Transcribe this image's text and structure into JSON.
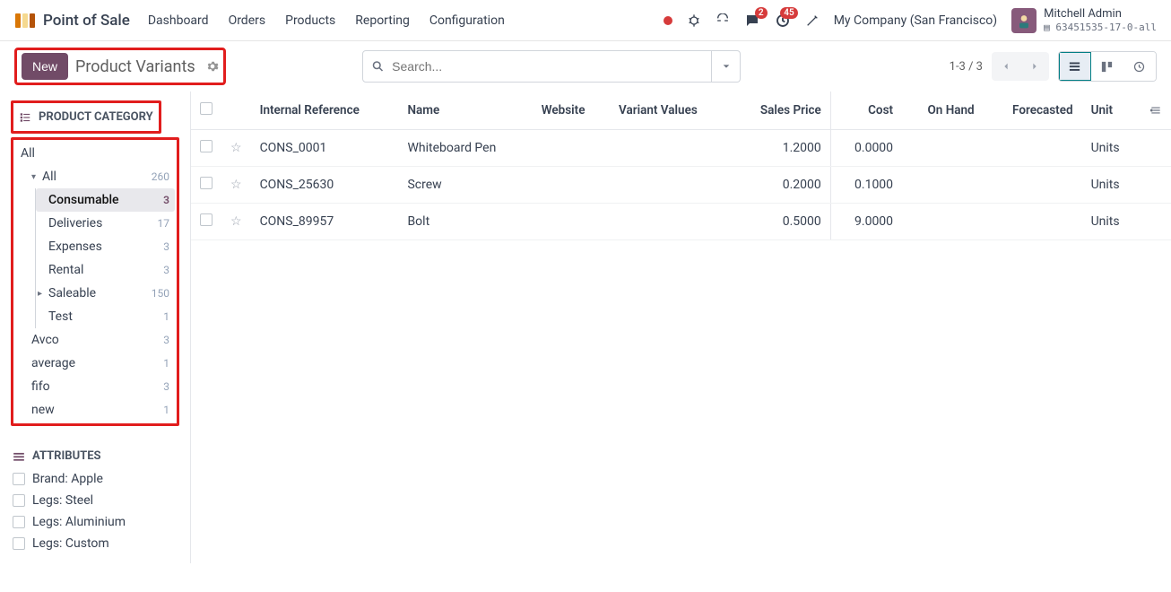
{
  "app": {
    "name": "Point of Sale"
  },
  "nav": [
    "Dashboard",
    "Orders",
    "Products",
    "Reporting",
    "Configuration"
  ],
  "topbar": {
    "chat_badge": "2",
    "activity_badge": "45",
    "company": "My Company (San Francisco)",
    "user_name": "Mitchell Admin",
    "db": "63451535-17-0-all"
  },
  "controls": {
    "new_label": "New",
    "breadcrumb": "Product Variants",
    "search_placeholder": "Search...",
    "pager": "1-3 / 3"
  },
  "sidebar": {
    "cat_header": "PRODUCT CATEGORY",
    "attr_header": "ATTRIBUTES",
    "categories_top": [
      {
        "label": "All",
        "count": ""
      }
    ],
    "categories": [
      {
        "label": "All",
        "count": "260",
        "caret": "▾",
        "indent": 0
      },
      {
        "label": "Consumable",
        "count": "3",
        "indent": 2,
        "selected": true
      },
      {
        "label": "Deliveries",
        "count": "17",
        "indent": 2
      },
      {
        "label": "Expenses",
        "count": "3",
        "indent": 2
      },
      {
        "label": "Rental",
        "count": "3",
        "indent": 2
      },
      {
        "label": "Saleable",
        "count": "150",
        "caret": "▸",
        "indent": 1
      },
      {
        "label": "Test",
        "count": "1",
        "indent": 2
      }
    ],
    "categories_bottom": [
      {
        "label": "Avco",
        "count": "3"
      },
      {
        "label": "average",
        "count": "1"
      },
      {
        "label": "fifo",
        "count": "3"
      },
      {
        "label": "new",
        "count": "1"
      }
    ],
    "attributes": [
      "Brand: Apple",
      "Legs: Steel",
      "Legs: Aluminium",
      "Legs: Custom"
    ]
  },
  "table": {
    "headers": {
      "ref": "Internal Reference",
      "name": "Name",
      "website": "Website",
      "variant": "Variant Values",
      "price": "Sales Price",
      "cost": "Cost",
      "onhand": "On Hand",
      "forecast": "Forecasted",
      "unit": "Unit"
    },
    "rows": [
      {
        "ref": "CONS_0001",
        "name": "Whiteboard Pen",
        "price": "1.2000",
        "cost": "0.0000",
        "unit": "Units"
      },
      {
        "ref": "CONS_25630",
        "name": "Screw",
        "price": "0.2000",
        "cost": "0.1000",
        "unit": "Units"
      },
      {
        "ref": "CONS_89957",
        "name": "Bolt",
        "price": "0.5000",
        "cost": "9.0000",
        "unit": "Units"
      }
    ]
  }
}
